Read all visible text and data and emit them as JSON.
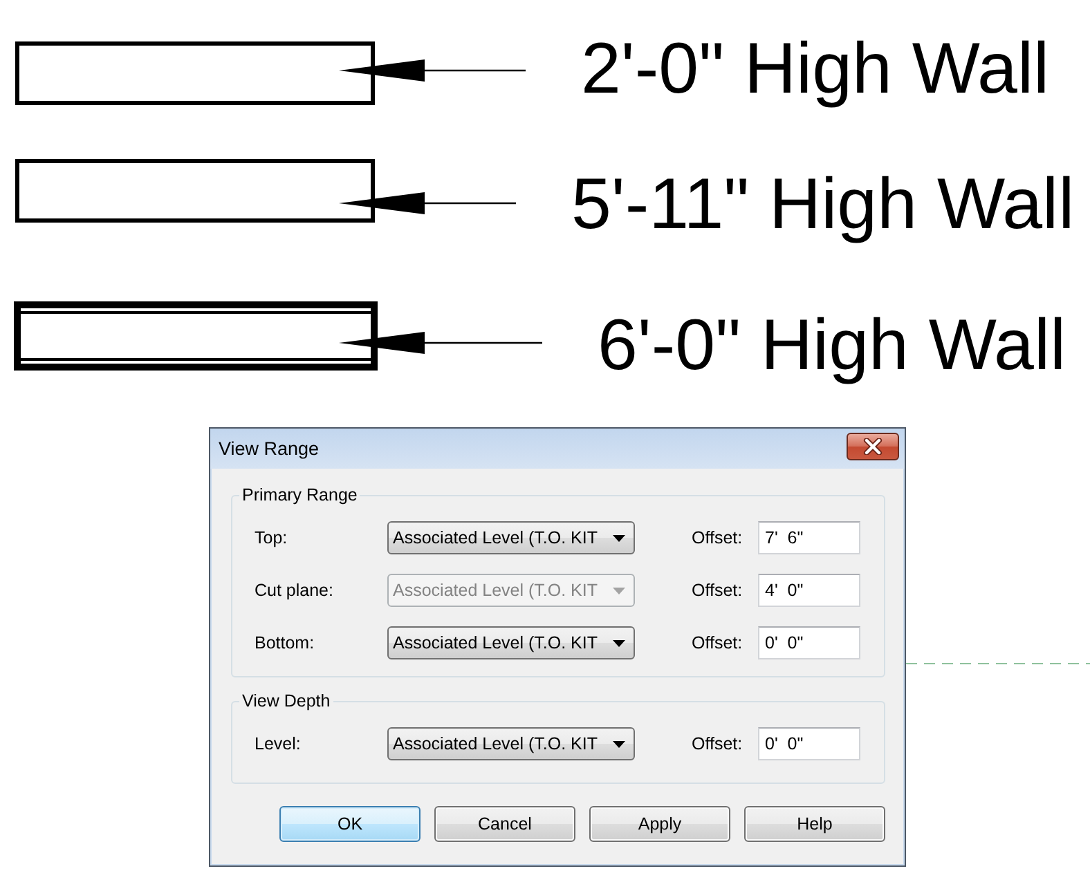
{
  "drawing": {
    "walls": [
      {
        "kind": "single",
        "label": "2'-0\" High Wall"
      },
      {
        "kind": "single",
        "label": "5'-11\" High Wall"
      },
      {
        "kind": "double",
        "label": "6'-0\" High Wall"
      }
    ]
  },
  "dialog": {
    "title": "View Range",
    "groups": [
      {
        "title": "Primary Range",
        "rows": [
          {
            "label": "Top:",
            "dropdown": {
              "value": "Associated Level (T.O. KIT",
              "disabled": false
            },
            "offset_label": "Offset:",
            "offset": "7'  6\""
          },
          {
            "label": "Cut plane:",
            "dropdown": {
              "value": "Associated Level (T.O. KIT",
              "disabled": true
            },
            "offset_label": "Offset:",
            "offset": "4'  0\""
          },
          {
            "label": "Bottom:",
            "dropdown": {
              "value": "Associated Level (T.O. KIT",
              "disabled": false
            },
            "offset_label": "Offset:",
            "offset": "0'  0\""
          }
        ]
      },
      {
        "title": "View Depth",
        "rows": [
          {
            "label": "Level:",
            "dropdown": {
              "value": "Associated Level (T.O. KIT",
              "disabled": false
            },
            "offset_label": "Offset:",
            "offset": "0'  0\""
          }
        ]
      }
    ],
    "buttons": [
      {
        "label": "OK",
        "default": true
      },
      {
        "label": "Cancel",
        "default": false
      },
      {
        "label": "Apply",
        "default": false
      },
      {
        "label": "Help",
        "default": false
      }
    ]
  }
}
